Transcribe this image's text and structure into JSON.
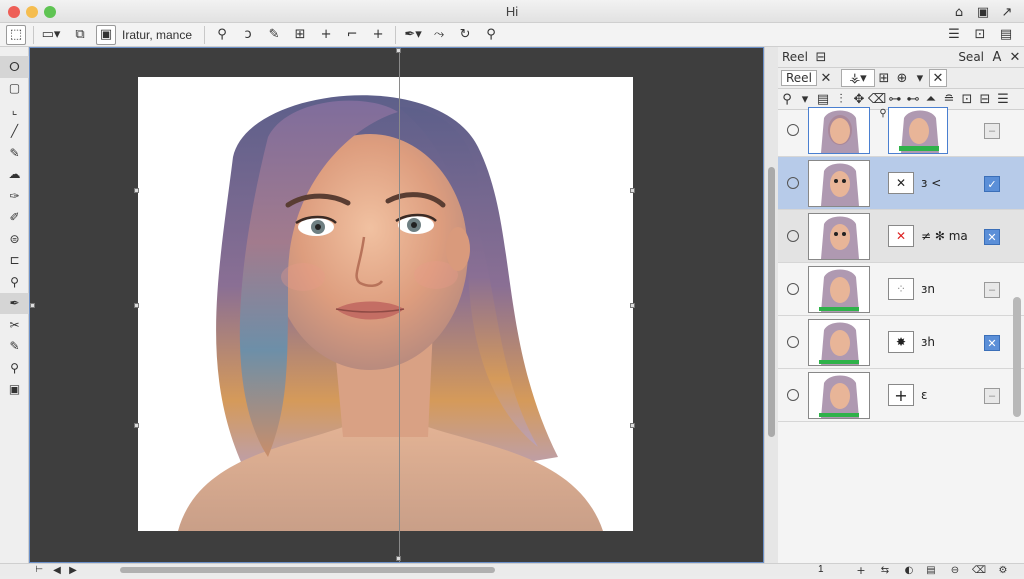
{
  "window": {
    "title": "Hi"
  },
  "toolbar": {
    "mode_label": "Iratur, mance"
  },
  "layers_panel": {
    "tab1": "Reel",
    "tab2": "Seal",
    "tab3": "Reel",
    "layers": [
      {
        "name": "",
        "mask_glyph": "",
        "checked": false,
        "selected": false
      },
      {
        "name": "ɜ <",
        "mask_glyph": "✕",
        "checked": true,
        "selected": true
      },
      {
        "name": "≠ ✻ ma",
        "mask_glyph": "✕",
        "checked": true,
        "selected": false
      },
      {
        "name": "ɜn",
        "mask_glyph": "⁘",
        "checked": false,
        "selected": false
      },
      {
        "name": "ɜh",
        "mask_glyph": "✸",
        "checked": true,
        "selected": false
      },
      {
        "name": "ɛ",
        "mask_glyph": "+",
        "checked": false,
        "selected": false
      }
    ],
    "page_number": "1"
  },
  "colors": {
    "selection": "#b7cbe9",
    "accent": "#5b8fd8"
  }
}
